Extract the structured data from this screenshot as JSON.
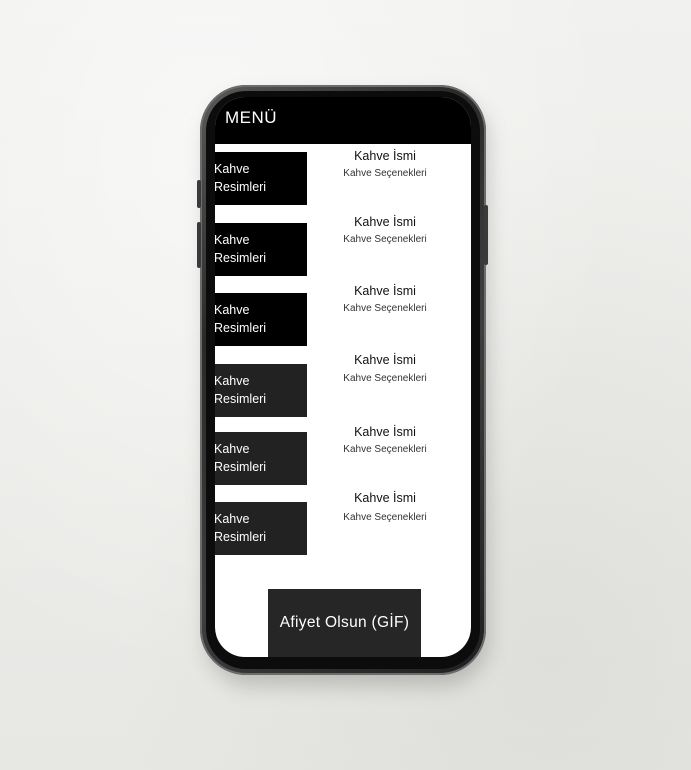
{
  "header": {
    "title": "MENÜ"
  },
  "items": [
    {
      "image_line1": "Kahve",
      "image_line2": "Resimleri",
      "name": "Kahve İsmi",
      "options": "Kahve Seçenekleri"
    },
    {
      "image_line1": "Kahve",
      "image_line2": "Resimleri",
      "name": "Kahve İsmi",
      "options": "Kahve Seçenekleri"
    },
    {
      "image_line1": "Kahve",
      "image_line2": "Resimleri",
      "name": "Kahve İsmi",
      "options": "Kahve Seçenekleri"
    },
    {
      "image_line1": "Kahve",
      "image_line2": "Resimleri",
      "name": "Kahve İsmi",
      "options": "Kahve Seçenekleri"
    },
    {
      "image_line1": "Kahve",
      "image_line2": "Resimleri",
      "name": "Kahve İsmi",
      "options": "Kahve Seçenekleri"
    },
    {
      "image_line1": "Kahve",
      "image_line2": "Resimleri",
      "name": "Kahve İsmi",
      "options": "Kahve Seçenekleri"
    }
  ],
  "footer": {
    "gif_label": "Afiyet Olsun (GİF)"
  },
  "colors": {
    "header_bg": "#000000",
    "image_box_bg": "#000000",
    "image_box_alt_bg": "#222222",
    "gif_bg": "#262626"
  }
}
